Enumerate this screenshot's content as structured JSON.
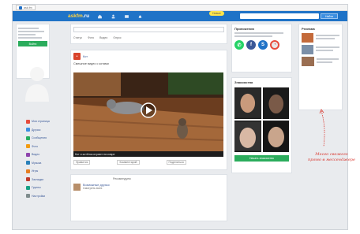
{
  "brand": {
    "name_main": "ask",
    "name_accent": "fm",
    "name_rest": ".ru"
  },
  "topbar": {
    "bubble": "Новые",
    "search_button": "Найти"
  },
  "left": {
    "join_button": "Войти",
    "menu_items": [
      {
        "label": "Моя страница",
        "color": "#e74c3c"
      },
      {
        "label": "Друзья",
        "color": "#3b8fe0"
      },
      {
        "label": "Сообщения",
        "color": "#27ae60"
      },
      {
        "label": "Фото",
        "color": "#f39c12"
      },
      {
        "label": "Видео",
        "color": "#8e44ad"
      },
      {
        "label": "Музыка",
        "color": "#2980b9"
      },
      {
        "label": "Игры",
        "color": "#e67e22"
      },
      {
        "label": "Закладки",
        "color": "#c0392b"
      },
      {
        "label": "Группы",
        "color": "#16a085"
      },
      {
        "label": "Настройки",
        "color": "#7f8c8d"
      }
    ]
  },
  "feed": {
    "composer_tabs": [
      "Статус",
      "Фото",
      "Видео",
      "Опрос"
    ],
    "post": {
      "author": "Кот",
      "text": "Смешное видео с котами",
      "caption": "Кот и котёнок играют на ковре",
      "like": "Нравится",
      "share": "Поделиться",
      "comment": "Комментарий"
    },
    "suggest_title": "Рекомендуем",
    "suggest_name": "Возможные друзья",
    "suggest_sub": "Смотреть всех"
  },
  "right": {
    "panel_title": "Приложения",
    "faces_title": "Знакомства",
    "faces_button": "Начать знакомство",
    "ads_title": "Реклама"
  },
  "annotation": {
    "lines": [
      "Много свежего",
      "прямо в мессенджере"
    ]
  }
}
